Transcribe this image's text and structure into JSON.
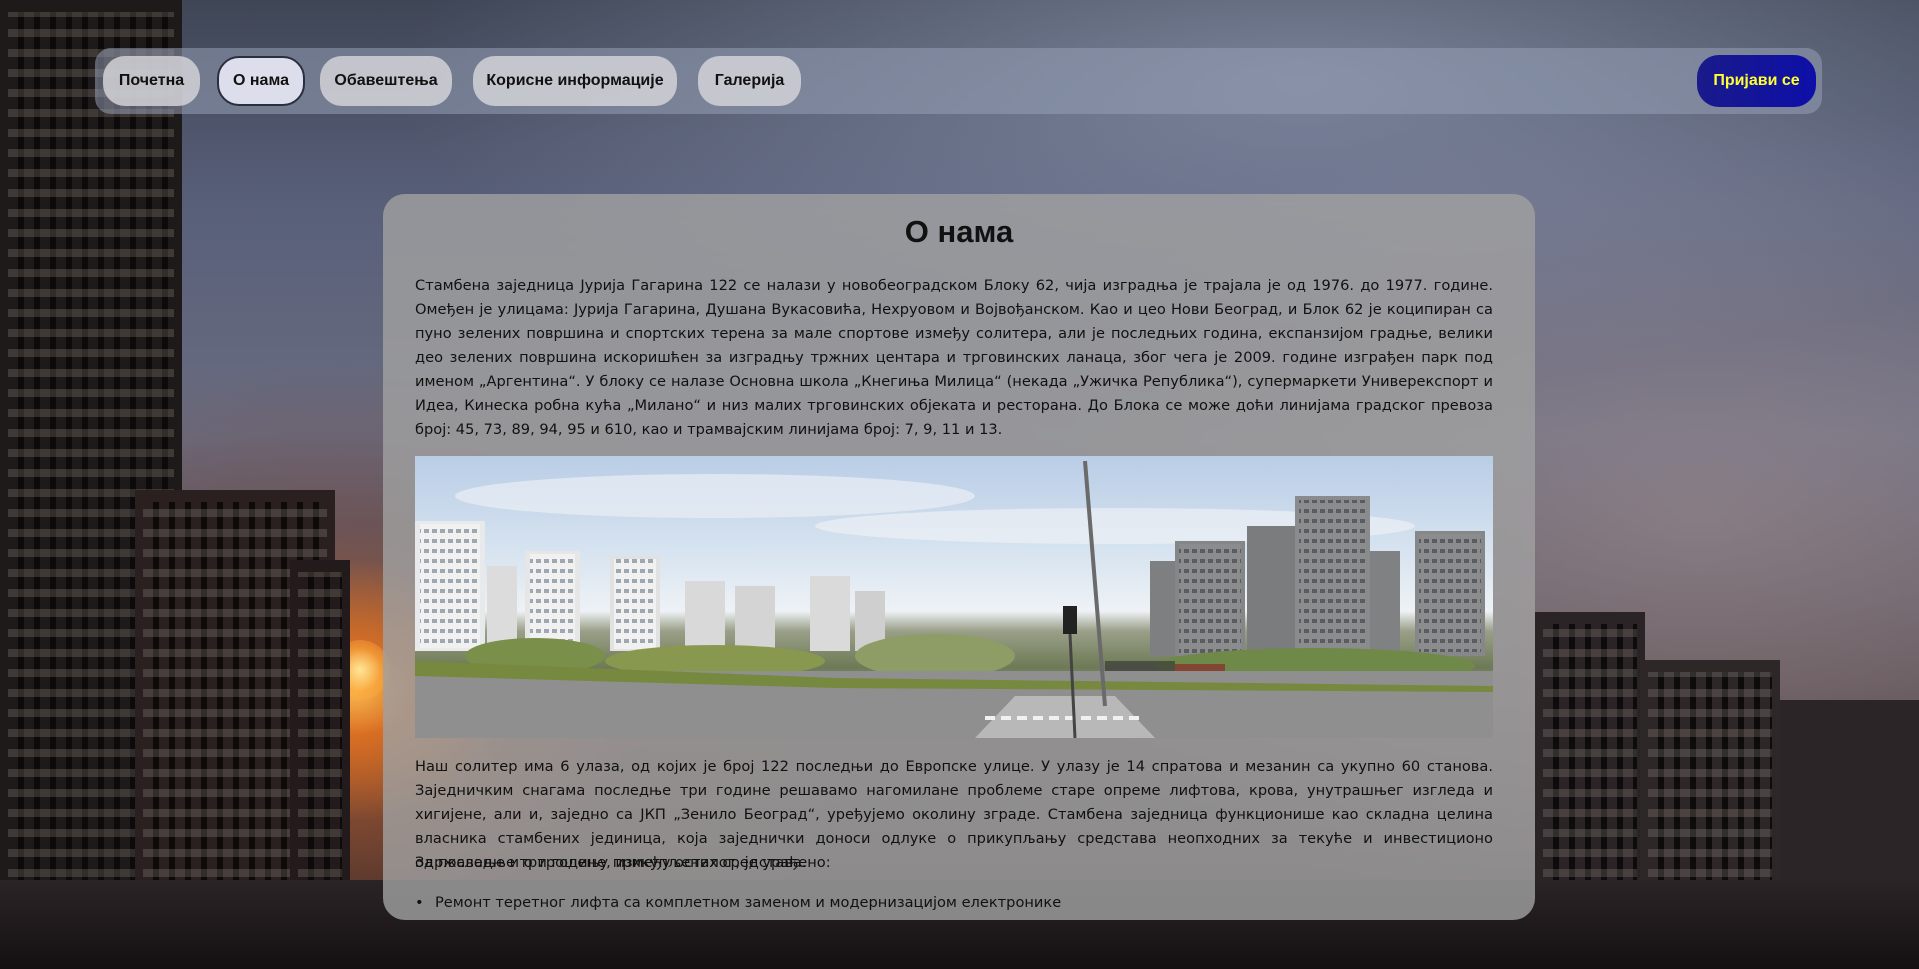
{
  "nav": {
    "items": [
      {
        "label": "Почетна",
        "active": false
      },
      {
        "label": "О нама",
        "active": true
      },
      {
        "label": "Обавештења",
        "active": false
      },
      {
        "label": "Корисне информације",
        "active": false
      },
      {
        "label": "Галерија",
        "active": false
      }
    ],
    "login_label": "Пријави се"
  },
  "colors": {
    "login_bg": "#0d0fa8",
    "login_text": "#ffff33"
  },
  "main": {
    "title": "О нама",
    "paragraph1": "Стамбена заједница Јурија Гагарина 122 се налази у новобеоградском Блоку 62, чија изградња је трајала је од 1976. до 1977. године. Омеђен је улицама: Јурија Гагарина, Душана Вукасовића, Нехруовом и Војвођанском. Као и цео Нови Београд, и Блок 62 је коципиран са пуно зелених површина и спортских терена за мале спортове између солитера, али је последњих година, експанзијом градње, велики део зелених површина искоришћен за изградњу тржних центара и трговинских ланаца, због чега је 2009. године изграђен парк под именом „Аргентина“. У блоку се налазе Основна школа „Кнегиња Милица“ (некада „Ужичка Република“), супермаркети Универекспорт и Идеа, Кинеска робна кућа „Милано“ и низ малих трговинских објеката и ресторана. До Блока се може доћи линијама градског превоза број: 45, 73, 89, 94, 95 и 610, као и трамвајским линијама број: 7, 9, 11 и 13.",
    "paragraph2": "Наш солитер има 6 улаза, од којих је број 122 последњи до Европске улице. У улазу је 14 спратова и мезанин са укупно 60 станова. Заједничким снагама последње три године решавамо нагомилане проблеме старе опреме лифтова, крова, унутрашњег изгледа и хигијене, али и, заједно са ЈКП „Зенило Београд“, уређујемо околину зграде. Стамбена заједница функционише као складна целина власника стамбених јединица, која заједнички доноси одлуке о прикупљању средстава неопходних за текуће и инвестиционо одржавање и о трошењу прикупљених средстава.",
    "paragraph3": "За последње три године, између осталог, је урађено:",
    "bullets": [
      "Ремонт теретног лифта са комплетном заменом и модернизацијом електронике"
    ]
  }
}
